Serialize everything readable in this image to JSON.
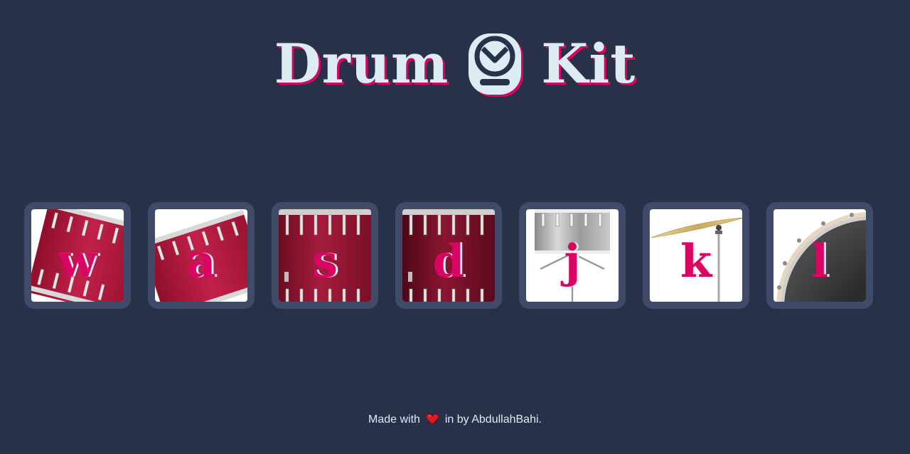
{
  "header": {
    "title_left": "Drum",
    "title_right": "Kit",
    "logo_icon": "drum-logo-icon"
  },
  "drums": [
    {
      "key": "w",
      "icon": "tom-drum-icon"
    },
    {
      "key": "a",
      "icon": "tom-drum-icon"
    },
    {
      "key": "s",
      "icon": "floor-tom-icon"
    },
    {
      "key": "d",
      "icon": "floor-tom-icon"
    },
    {
      "key": "j",
      "icon": "snare-drum-icon"
    },
    {
      "key": "k",
      "icon": "crash-cymbal-icon"
    },
    {
      "key": "l",
      "icon": "kick-drum-icon"
    }
  ],
  "footer": {
    "made_with": "Made with",
    "by_text": "in by AbdullahBahi.",
    "heart_icon": "heart-icon"
  },
  "colors": {
    "background": "#283149",
    "button": "#404b69",
    "text_light": "#dbedf3",
    "accent": "#da0463"
  }
}
